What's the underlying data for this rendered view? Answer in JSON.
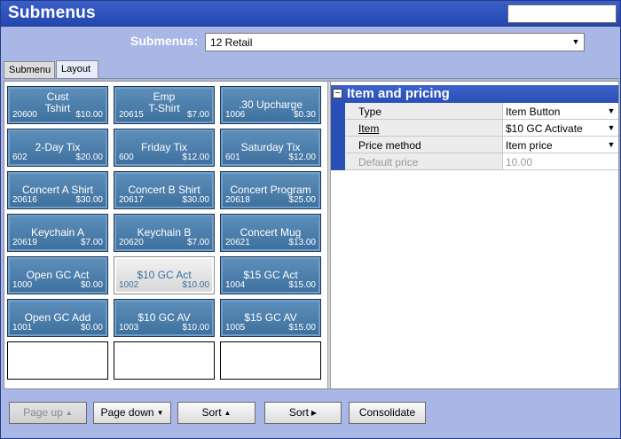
{
  "window": {
    "title": "Submenus"
  },
  "submenu_selector": {
    "label": "Submenus:",
    "value": "12 Retail"
  },
  "tabs": [
    {
      "label": "Submenu"
    },
    {
      "label": "Layout"
    }
  ],
  "buttons": [
    {
      "name_lines": [
        "Cust",
        "Tshirt"
      ],
      "code": "20600",
      "price": "$10.00"
    },
    {
      "name_lines": [
        "Emp",
        "T-Shirt"
      ],
      "code": "20615",
      "price": "$7.00"
    },
    {
      "name_lines": [
        ".30 Upcharge"
      ],
      "code": "1006",
      "price": "$0.30"
    },
    {
      "name_lines": [
        "2-Day Tix"
      ],
      "code": "602",
      "price": "$20.00"
    },
    {
      "name_lines": [
        "Friday Tix"
      ],
      "code": "600",
      "price": "$12.00"
    },
    {
      "name_lines": [
        "Saturday Tix"
      ],
      "code": "601",
      "price": "$12.00"
    },
    {
      "name_lines": [
        "Concert A Shirt"
      ],
      "code": "20616",
      "price": "$30.00"
    },
    {
      "name_lines": [
        "Concert B Shirt"
      ],
      "code": "20617",
      "price": "$30.00"
    },
    {
      "name_lines": [
        "Concert Program"
      ],
      "code": "20618",
      "price": "$25.00"
    },
    {
      "name_lines": [
        "Keychain A"
      ],
      "code": "20619",
      "price": "$7.00"
    },
    {
      "name_lines": [
        "Keychain B"
      ],
      "code": "20620",
      "price": "$7.00"
    },
    {
      "name_lines": [
        "Concert Mug"
      ],
      "code": "20621",
      "price": "$13.00"
    },
    {
      "name_lines": [
        "Open GC Act"
      ],
      "code": "1000",
      "price": "$0.00"
    },
    {
      "name_lines": [
        "$10 GC Act"
      ],
      "code": "1002",
      "price": "$10.00",
      "selected": true
    },
    {
      "name_lines": [
        "$15 GC Act"
      ],
      "code": "1004",
      "price": "$15.00"
    },
    {
      "name_lines": [
        "Open GC Add"
      ],
      "code": "1001",
      "price": "$0.00"
    },
    {
      "name_lines": [
        "$10 GC AV"
      ],
      "code": "1003",
      "price": "$10.00"
    },
    {
      "name_lines": [
        "$15 GC AV"
      ],
      "code": "1005",
      "price": "$15.00"
    }
  ],
  "properties": {
    "section_title": "Item and pricing",
    "toggle_symbol": "−",
    "rows": [
      {
        "key": "Type",
        "value": "Item Button",
        "dropdown": true
      },
      {
        "key": "Item",
        "value": "$10 GC Activate",
        "dropdown": true
      },
      {
        "key": "Price method",
        "value": "Item price",
        "dropdown": true
      },
      {
        "key": "Default price",
        "value": "10.00",
        "dropdown": false
      }
    ]
  },
  "bottom_buttons": [
    {
      "label": "Page up",
      "arrow": "▲",
      "disabled": true
    },
    {
      "label": "Page down",
      "arrow": "▼"
    },
    {
      "label": "Sort",
      "arrow": "▲"
    },
    {
      "label": "Sort",
      "arrow": "▶"
    },
    {
      "label": "Consolidate",
      "arrow": ""
    }
  ],
  "icons": {
    "dropdown_arrow": "▼"
  }
}
